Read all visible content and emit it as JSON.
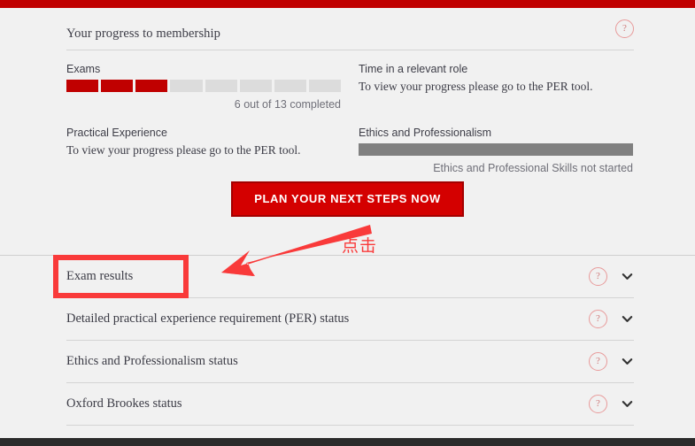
{
  "theme": {
    "brand_red": "#c00000",
    "button_red": "#d40000",
    "button_border": "#a30000",
    "annotation_red": "#f93a3a",
    "page_background": "#f1f1f1",
    "footer_dark": "#2b2b2b",
    "segment_gray": "#dcdcdc",
    "solid_bar_gray": "#808080",
    "help_icon_border": "#e89a9a"
  },
  "progress_panel": {
    "title": "Your progress to membership",
    "help_icon": "question-mark-circle-icon",
    "help_icon_label": "?",
    "items": [
      {
        "heading": "Exams",
        "type": "segmented-progress",
        "total_segments": 8,
        "filled_segments": 3.6,
        "caption": "6 out of 13 completed",
        "completed": 6,
        "total": 13
      },
      {
        "heading": "Time in a relevant role",
        "type": "note",
        "note": "To view your progress please go to the PER tool."
      },
      {
        "heading": "Practical Experience",
        "type": "note",
        "note": "To view your progress please go to the PER tool."
      },
      {
        "heading": "Ethics and Professionalism",
        "type": "solid-bar",
        "caption": "Ethics and Professional Skills not started"
      }
    ]
  },
  "cta": {
    "label": "PLAN YOUR NEXT STEPS NOW"
  },
  "accordion": {
    "rows": [
      {
        "label": "Exam results",
        "help_icon": "question-mark-circle-icon",
        "help_icon_label": "?",
        "chevron_icon": "chevron-down-icon",
        "highlighted": true
      },
      {
        "label": "Detailed practical experience requirement (PER) status",
        "help_icon": "question-mark-circle-icon",
        "help_icon_label": "?",
        "chevron_icon": "chevron-down-icon",
        "highlighted": false
      },
      {
        "label": "Ethics and Professionalism status",
        "help_icon": "question-mark-circle-icon",
        "help_icon_label": "?",
        "chevron_icon": "chevron-down-icon",
        "highlighted": false
      },
      {
        "label": "Oxford Brookes status",
        "help_icon": "question-mark-circle-icon",
        "help_icon_label": "?",
        "chevron_icon": "chevron-down-icon",
        "highlighted": false
      }
    ]
  },
  "annotation": {
    "text": "点击",
    "arrow_icon": "arrow-pointing-left-icon",
    "box_target": "Exam results"
  }
}
